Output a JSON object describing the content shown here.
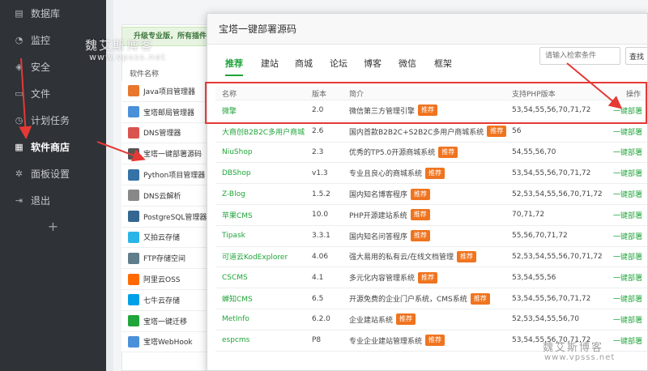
{
  "sidebar": {
    "items": [
      {
        "label": "数据库",
        "icon": "database-icon"
      },
      {
        "label": "监控",
        "icon": "monitor-icon"
      },
      {
        "label": "安全",
        "icon": "shield-icon"
      },
      {
        "label": "文件",
        "icon": "folder-icon"
      },
      {
        "label": "计划任务",
        "icon": "clock-icon"
      },
      {
        "label": "软件商店",
        "icon": "grid-icon",
        "active": true
      },
      {
        "label": "面板设置",
        "icon": "gear-icon"
      },
      {
        "label": "退出",
        "icon": "logout-icon"
      }
    ],
    "add_label": "+"
  },
  "background": {
    "upgrade_text": "升级专业版，所有插件",
    "software_header": "软件名称",
    "software": [
      {
        "name": "Java项目管理器",
        "color": "#e8762b"
      },
      {
        "name": "宝塔邮局管理器",
        "color": "#4a90d9"
      },
      {
        "name": "DNS管理器",
        "color": "#d9534f"
      },
      {
        "name": "宝塔一键部署源码",
        "color": "#555555"
      },
      {
        "name": "Python项目管理器",
        "color": "#3572a5"
      },
      {
        "name": "DNS云解析",
        "color": "#888888"
      },
      {
        "name": "PostgreSQL管理器",
        "color": "#336791"
      },
      {
        "name": "又拍云存储",
        "color": "#2ab5e8"
      },
      {
        "name": "FTP存储空间",
        "color": "#607d8b"
      },
      {
        "name": "阿里云OSS",
        "color": "#ff6a00"
      },
      {
        "name": "七牛云存储",
        "color": "#00a0e9"
      },
      {
        "name": "宝塔一键迁移",
        "color": "#20a53a"
      },
      {
        "name": "宝塔WebHook",
        "color": "#4a90d9"
      }
    ]
  },
  "watermark": {
    "text": "魏艾斯博客",
    "url": "www.vpsss.net"
  },
  "modal": {
    "title": "宝塔一键部署源码",
    "tabs": [
      "推荐",
      "建站",
      "商城",
      "论坛",
      "博客",
      "微信",
      "框架"
    ],
    "search_placeholder": "请输入检索条件",
    "search_button": "查找",
    "columns": {
      "name": "名称",
      "version": "版本",
      "desc": "简介",
      "php": "支持PHP版本",
      "op": "操作"
    },
    "badge_label": "推荐",
    "rows": [
      {
        "name": "微擎",
        "version": "2.0",
        "desc": "微信第三方管理引擎",
        "badge": true,
        "php": "53,54,55,56,70,71,72",
        "op": "一键部署"
      },
      {
        "name": "大商创B2B2C多用户商城",
        "version": "2.6",
        "desc": "国内首款B2B2C+S2B2C多用户商城系统",
        "badge": true,
        "php": "56",
        "op": "一键部署"
      },
      {
        "name": "NiuShop",
        "version": "2.3",
        "desc": "优秀的TP5.0开源商城系统",
        "badge": true,
        "php": "54,55,56,70",
        "op": "一键部署"
      },
      {
        "name": "DBShop",
        "version": "v1.3",
        "desc": "专业且良心的商城系统",
        "badge": true,
        "php": "53,54,55,56,70,71,72",
        "op": "一键部署"
      },
      {
        "name": "Z-Blog",
        "version": "1.5.2",
        "desc": "国内知名博客程序",
        "badge": true,
        "php": "52,53,54,55,56,70,71,72",
        "op": "一键部署"
      },
      {
        "name": "苹果CMS",
        "version": "10.0",
        "desc": "PHP开源建站系统",
        "badge": true,
        "php": "70,71,72",
        "op": "一键部署"
      },
      {
        "name": "Tipask",
        "version": "3.3.1",
        "desc": "国内知名问答程序",
        "badge": true,
        "php": "55,56,70,71,72",
        "op": "一键部署"
      },
      {
        "name": "可道云KodExplorer",
        "version": "4.06",
        "desc": "强大易用的私有云/在线文档管理",
        "badge": true,
        "php": "52,53,54,55,56,70,71,72",
        "op": "一键部署"
      },
      {
        "name": "CSCMS",
        "version": "4.1",
        "desc": "多元化内容管理系统",
        "badge": true,
        "php": "53,54,55,56",
        "op": "一键部署"
      },
      {
        "name": "蝉知CMS",
        "version": "6.5",
        "desc": "开源免费的企业门户系统，CMS系统",
        "badge": true,
        "php": "53,54,55,56,70,71,72",
        "op": "一键部署"
      },
      {
        "name": "MetInfo",
        "version": "6.2.0",
        "desc": "企业建站系统",
        "badge": true,
        "php": "52,53,54,55,56,70",
        "op": "一键部署"
      },
      {
        "name": "espcms",
        "version": "P8",
        "desc": "专业企业建站管理系统",
        "badge": true,
        "php": "53,54,55,56,70,71,72",
        "op": "一键部署"
      }
    ]
  },
  "colors": {
    "accent": "#20a53a",
    "badge": "#f0741f",
    "highlight": "#e53935",
    "sidebar_bg": "#2f3237"
  }
}
